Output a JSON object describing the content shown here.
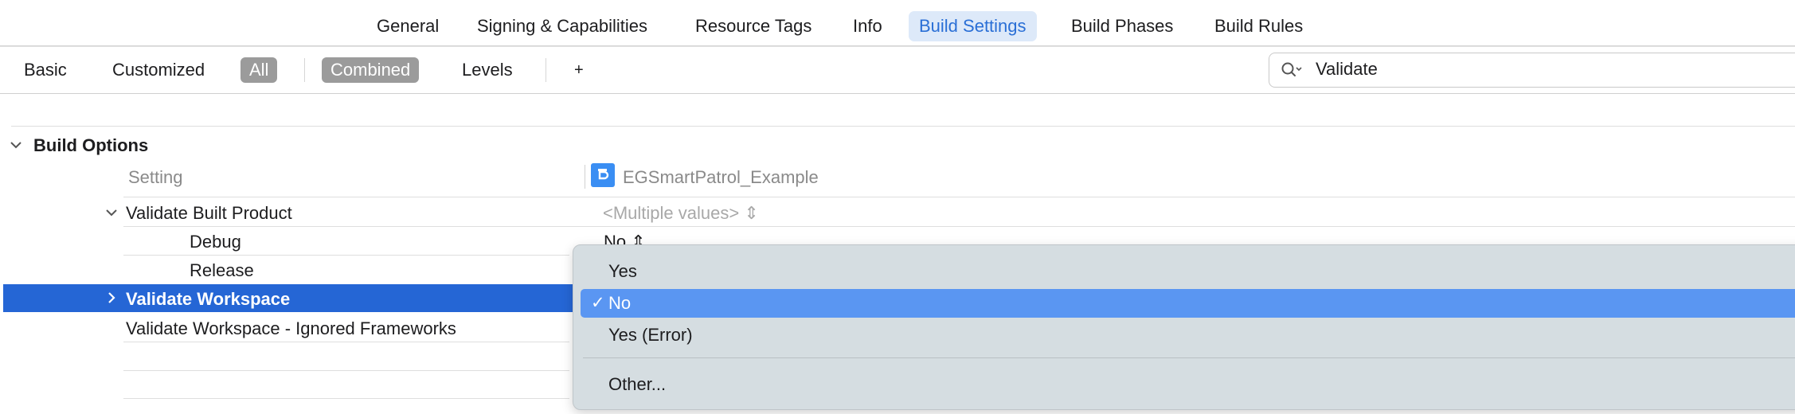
{
  "tabs": [
    "General",
    "Signing & Capabilities",
    "Resource Tags",
    "Info",
    "Build Settings",
    "Build Phases",
    "Build Rules"
  ],
  "filters": {
    "basic": "Basic",
    "customized": "Customized",
    "all": "All",
    "combined": "Combined",
    "levels": "Levels",
    "add": "+"
  },
  "search": {
    "value": "Validate"
  },
  "section": {
    "title": "Build Options"
  },
  "columns": {
    "setting": "Setting",
    "target": "EGSmartPatrol_Example"
  },
  "rows": {
    "validate_built_product": {
      "label": "Validate Built Product",
      "value": "<Multiple values> ⇕"
    },
    "debug": {
      "label": "Debug",
      "value": "No ⇕"
    },
    "release": {
      "label": "Release"
    },
    "validate_workspace": {
      "label": "Validate Workspace"
    },
    "ignored_frameworks": {
      "label": "Validate Workspace - Ignored Frameworks"
    }
  },
  "menu": {
    "items": [
      "Yes",
      "No",
      "Yes (Error)",
      "Other..."
    ],
    "selected": "No",
    "check": "✓"
  },
  "colors": {
    "accent": "#2566d5",
    "menu_highlight": "#5a96f2",
    "active_tab": "#dde9f9"
  }
}
